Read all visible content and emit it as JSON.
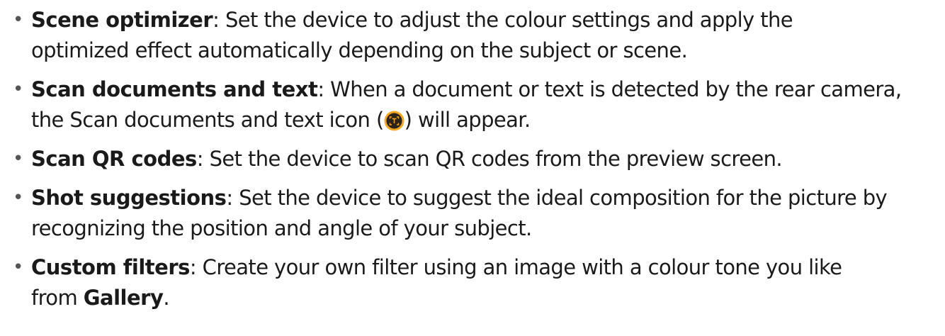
{
  "items": [
    {
      "term": "Scene optimizer",
      "sep": ":",
      "line1": " Set the device to adjust the colour settings and apply the",
      "line2": "optimized effect automatically depending on the subject or scene."
    },
    {
      "term": "Scan documents and text",
      "sep": ":",
      "line1": " When a document or text is detected by the rear camera,",
      "line2_before": "the Scan documents and text icon (",
      "icon": "scan-text-icon",
      "icon_color": "#f5a623",
      "line2_after": ") will appear."
    },
    {
      "term": "Scan QR codes",
      "sep": ":",
      "line1": " Set the device to scan QR codes from the preview screen."
    },
    {
      "term": "Shot suggestions",
      "sep": ":",
      "line1": " Set the device to suggest the ideal composition for the picture by",
      "line2": "recognizing the position and angle of your subject."
    },
    {
      "term": "Custom filters",
      "sep": ":",
      "line1": " Create your own filter using an image with a colour tone you like",
      "line2_before": "from ",
      "line2_bold": "Gallery",
      "line2_after": "."
    }
  ],
  "bullet_char": "•"
}
